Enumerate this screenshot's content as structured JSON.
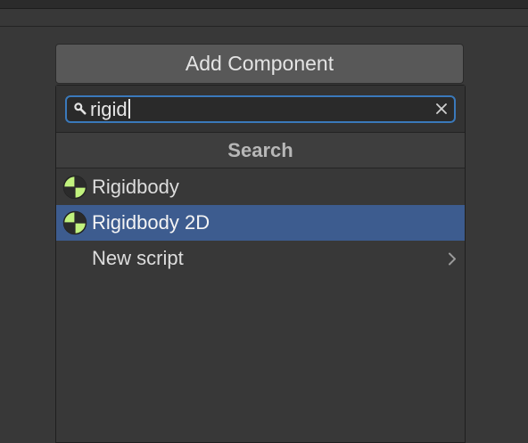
{
  "inspector": {
    "add_component_label": "Add Component"
  },
  "popup": {
    "search": {
      "query": "rigid",
      "icon": "search-icon",
      "clear_icon": "close-icon"
    },
    "section_title": "Search",
    "items": [
      {
        "label": "Rigidbody",
        "icon": "rigidbody-icon",
        "selected": false
      },
      {
        "label": "Rigidbody 2D",
        "icon": "rigidbody-icon",
        "selected": true
      },
      {
        "label": "New script",
        "icon": "chevron-right-icon",
        "selected": false
      }
    ]
  },
  "colors": {
    "background": "#383838",
    "button": "#585858",
    "search_focus_border": "#3a79bb",
    "selection": "#3d5c8f",
    "rigidbody_icon_fill": "#c1f27e"
  }
}
